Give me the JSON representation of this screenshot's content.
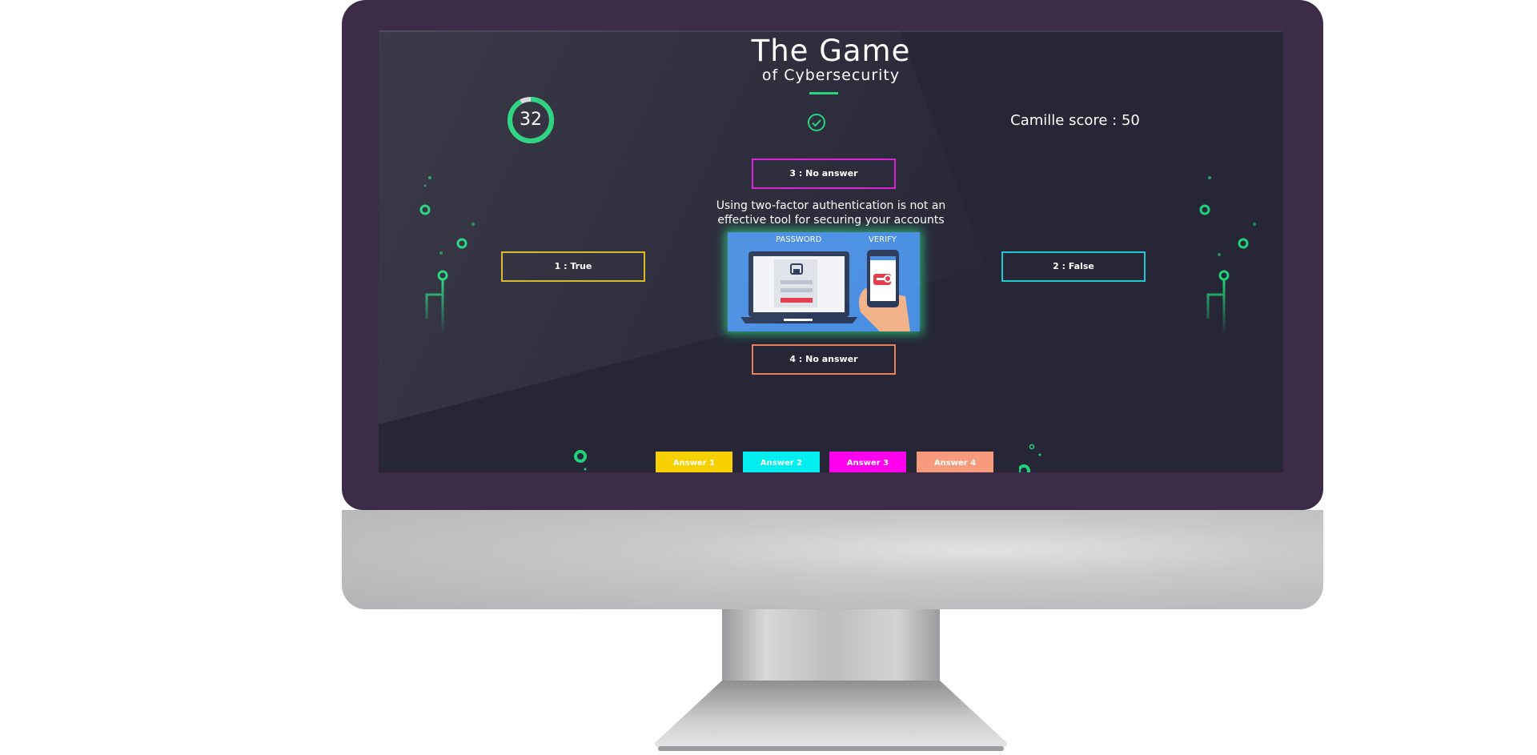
{
  "game": {
    "title_main": "The Game",
    "title_sub": "of Cybersecurity"
  },
  "timer": {
    "value": "32",
    "progress_fraction": 0.92
  },
  "status": {
    "icon": "check-circle-icon"
  },
  "score": {
    "label": "Camille score : 50"
  },
  "question": {
    "text": "Using two-factor authentication is not an effective tool for securing your accounts",
    "image": {
      "label_left": "PASSWORD",
      "label_right": "VERIFY"
    }
  },
  "answers": [
    {
      "label": "1 : True",
      "color": "#d8b51e"
    },
    {
      "label": "2 : False",
      "color": "#1ecad2"
    },
    {
      "label": "3 : No answer",
      "color": "#d81cd8"
    },
    {
      "label": "4 : No answer",
      "color": "#e8805a"
    }
  ],
  "buttons": [
    {
      "label": "Answer 1",
      "color": "#f7d000"
    },
    {
      "label": "Answer 2",
      "color": "#00eef0"
    },
    {
      "label": "Answer 3",
      "color": "#ff00ee"
    },
    {
      "label": "Answer 4",
      "color": "#f79b7c"
    }
  ],
  "colors": {
    "screen_bg": "#262636",
    "accent_green": "#1fd27a",
    "bezel": "#3c2c47"
  }
}
